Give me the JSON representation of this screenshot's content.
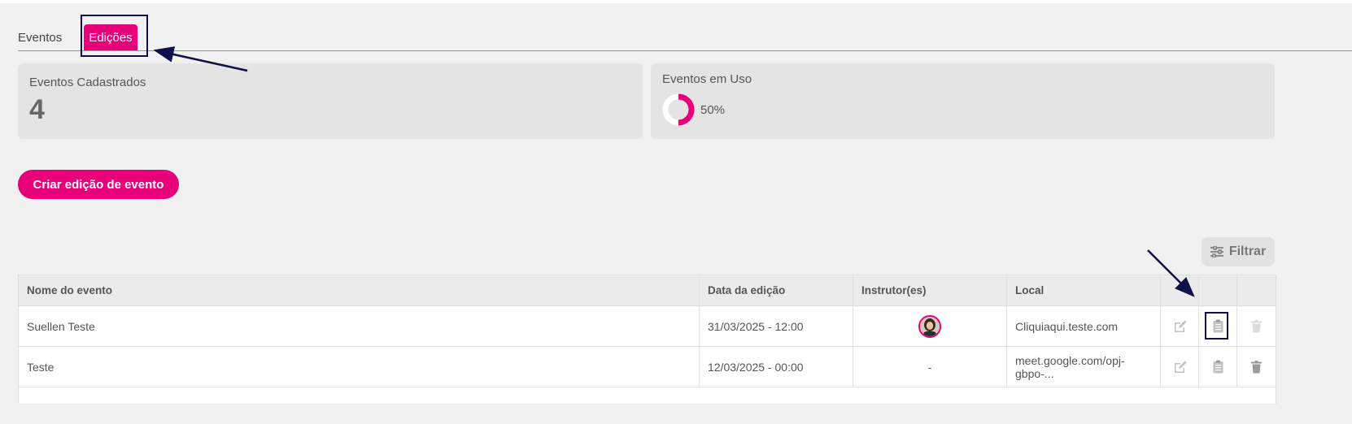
{
  "tabs": {
    "eventos": "Eventos",
    "edicoes": "Edições"
  },
  "stats": {
    "registered_title": "Eventos Cadastrados",
    "registered_value": "4",
    "in_use_title": "Eventos em Uso",
    "in_use_percent_label": "50%",
    "in_use_fraction": 0.5
  },
  "actions": {
    "create_label": "Criar edição de evento",
    "filter_label": "Filtrar"
  },
  "table": {
    "headers": [
      "Nome do evento",
      "Data da edição",
      "Instrutor(es)",
      "Local"
    ],
    "rows": [
      {
        "name": "Suellen Teste",
        "date": "31/03/2025 - 12:00",
        "instructor": "",
        "local": "Cliquiaqui.teste.com"
      },
      {
        "name": "Teste",
        "date": "12/03/2025 - 00:00",
        "instructor": "-",
        "local": "meet.google.com/opj-gbpo-..."
      }
    ]
  },
  "icons": {
    "edit": "edit-icon",
    "clipboard": "clipboard-icon",
    "delete": "trash-icon",
    "filter": "sliders-icon"
  },
  "colors": {
    "accent": "#e8007b",
    "annotation": "#0f0f4a"
  }
}
